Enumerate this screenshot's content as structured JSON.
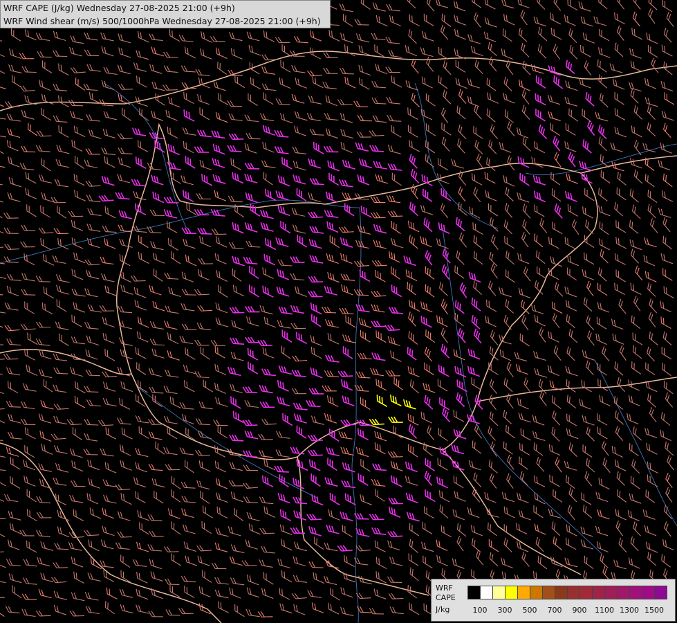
{
  "header": {
    "line1": "WRF CAPE (J/kg) Wednesday 27-08-2025 21:00 (+9h)",
    "line2": "WRF Wind shear (m/s) 500/1000hPa Wednesday 27-08-2025 21:00 (+9h)"
  },
  "legend": {
    "label1": "WRF",
    "label2": "CAPE",
    "label3": "J/kg",
    "ticks": [
      "100",
      "300",
      "500",
      "700",
      "900",
      "1100",
      "1300",
      "1500"
    ],
    "colors": [
      "#000000",
      "#ffffff",
      "#ffff99",
      "#ffff00",
      "#ffaa00",
      "#cc7700",
      "#a05018",
      "#8a3a1a",
      "#983030",
      "#a02a3a",
      "#a02448",
      "#a01e58",
      "#a01868",
      "#a01278",
      "#a00c88",
      "#8e0a90"
    ]
  },
  "map": {
    "barb_colors": {
      "weak": "#c77a6e",
      "moderate": "#f08070",
      "strong": "#e830e8",
      "extreme": "#ffff00"
    },
    "border_color": "#e8b89a",
    "river_color": "#3a6aa8"
  }
}
